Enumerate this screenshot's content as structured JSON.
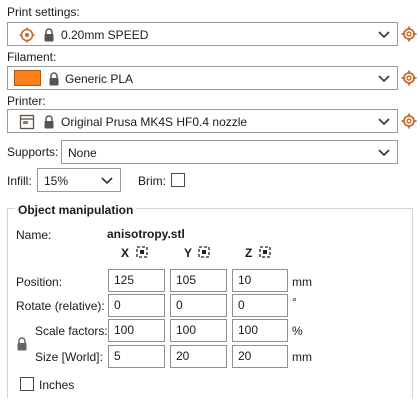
{
  "print_settings": {
    "label": "Print settings:",
    "value": "0.20mm SPEED"
  },
  "filament": {
    "label": "Filament:",
    "value": "Generic PLA",
    "color": "#ff7f1a"
  },
  "printer": {
    "label": "Printer:",
    "value": "Original Prusa MK4S HF0.4 nozzle"
  },
  "supports": {
    "label": "Supports:",
    "value": "None"
  },
  "infill": {
    "label": "Infill:",
    "value": "15%"
  },
  "brim": {
    "label": "Brim:",
    "checked": false
  },
  "object_manipulation": {
    "title": "Object manipulation",
    "name_label": "Name:",
    "name_value": "anisotropy.stl",
    "axes": [
      "X",
      "Y",
      "Z"
    ],
    "position": {
      "label": "Position:",
      "values": [
        "125",
        "105",
        "10"
      ],
      "unit": "mm"
    },
    "rotate": {
      "label": "Rotate (relative):",
      "values": [
        "0",
        "0",
        "0"
      ],
      "unit": "°"
    },
    "scale": {
      "label": "Scale factors:",
      "values": [
        "100",
        "100",
        "100"
      ],
      "unit": "%"
    },
    "size": {
      "label": "Size [World]:",
      "values": [
        "5",
        "20",
        "20"
      ],
      "unit": "mm"
    },
    "inches": {
      "label": "Inches",
      "checked": false
    }
  },
  "icons": {
    "profile": "system-profile-icon",
    "lock": "lock-icon",
    "gear": "gear-icon",
    "printer": "printer-icon",
    "axis": "axis-drop-to-bed-icon"
  }
}
